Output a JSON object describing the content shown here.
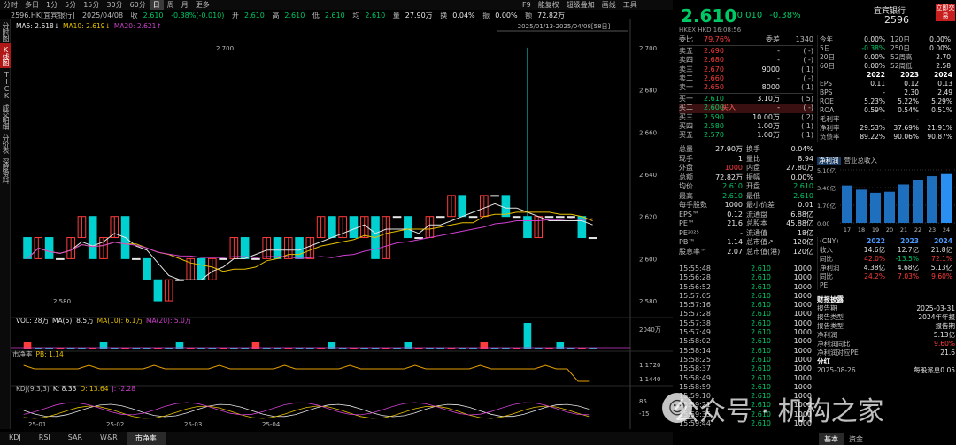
{
  "topbar": {
    "tabs": [
      "分时",
      "多日",
      "1分",
      "5分",
      "15分",
      "30分",
      "60分",
      "日",
      "周",
      "月",
      "更多"
    ],
    "active": "日",
    "right_items": [
      "F9",
      "能复权",
      "超级叠加",
      "画线",
      "工具"
    ]
  },
  "infobar": {
    "symbol": "2596.HK[宜宾银行]",
    "date": "2025/04/08",
    "close_label": "收",
    "close": "2.610",
    "change": "-0.38%(-0.010)",
    "open_label": "开",
    "open": "2.610",
    "high_label": "高",
    "high": "2.610",
    "low_label": "低",
    "low": "2.610",
    "avg_label": "均",
    "avg": "2.610",
    "vol_label": "量",
    "vol": "27.90万",
    "turn_label": "换",
    "turn": "0.04%",
    "amp_label": "振",
    "amp": "0.00%",
    "amt_label": "额",
    "amt": "72.82万"
  },
  "leftnav": [
    "分时图",
    "K线图",
    "TICK",
    "成交明细",
    "分价表",
    "深度资料"
  ],
  "leftnav_active": "K线图",
  "ma_legend": {
    "ma5": "MA5: 2.618↓",
    "ma10": "MA10: 2.619↓",
    "ma20": "MA20: 2.621↑"
  },
  "range_label": "2025/01/13-2025/04/08[58日]",
  "price_axis": [
    "2.700",
    "2.680",
    "2.660",
    "2.640",
    "2.620",
    "2.600",
    "2.580"
  ],
  "high_marker": "2.700",
  "low_marker": "2.580",
  "vol_legend": {
    "vol": "VOL: 28万",
    "ma5": "MA(5): 8.5万",
    "ma10": "MA(10): 6.1万",
    "ma20": "MA(20): 5.0万"
  },
  "vol_axis": "2040万",
  "pb_legend": {
    "name": "市净率",
    "value": "PB: 1.14"
  },
  "pb_axis": [
    "1.1720",
    "1.1440"
  ],
  "kdj_legend": {
    "name": "KDJ(9,3,3)",
    "k": "K: 8.33",
    "d": "D: 13.64",
    "j": "J: -2.28"
  },
  "kdj_axis": [
    "85",
    "-15"
  ],
  "date_axis": [
    "25-01",
    "25-02",
    "25-03",
    "25-04"
  ],
  "bottom_tabs": [
    "KDJ",
    "RSI",
    "SAR",
    "W&R",
    "市净率"
  ],
  "bottom_active": "市净率",
  "quote": {
    "price": "2.610",
    "change": "-0.010",
    "pct": "-0.38%",
    "name": "宜宾银行",
    "code": "2596",
    "trade_btn": "立即交易",
    "exchange": "HKEX  HKD  16:08:56"
  },
  "orderbook": {
    "ratio_label": "委比",
    "ratio": "79.76%",
    "diff_label": "委差",
    "diff": "1340",
    "asks": [
      {
        "l": "卖五",
        "p": "2.690",
        "v": "-",
        "n": "(      -)"
      },
      {
        "l": "卖四",
        "p": "2.680",
        "v": "-",
        "n": "(      -)"
      },
      {
        "l": "卖三",
        "p": "2.670",
        "v": "9000",
        "n": "(      1)"
      },
      {
        "l": "卖二",
        "p": "2.660",
        "v": "-",
        "n": "(      -)"
      },
      {
        "l": "卖一",
        "p": "2.650",
        "v": "8000",
        "n": "(      1)"
      }
    ],
    "bids": [
      {
        "l": "买一",
        "p": "2.610",
        "v": "3.10万",
        "n": "(      5)"
      },
      {
        "l": "买二",
        "p": "2.600",
        "v": "-",
        "n": "(      -)",
        "tag": "买入"
      },
      {
        "l": "买三",
        "p": "2.590",
        "v": "10.00万",
        "n": "(      2)"
      },
      {
        "l": "买四",
        "p": "2.580",
        "v": "1.00万",
        "n": "(      1)"
      },
      {
        "l": "买五",
        "p": "2.570",
        "v": "1.00万",
        "n": "(      1)"
      }
    ]
  },
  "stats": [
    [
      "总量",
      "27.90万",
      "换手",
      "0.04%"
    ],
    [
      "现手",
      "1",
      "量比",
      "8.94"
    ],
    [
      "外盘",
      "1000",
      "内盘",
      "27.80万"
    ],
    [
      "总额",
      "72.82万",
      "振幅",
      "0.00%"
    ],
    [
      "均价",
      "2.610",
      "开盘",
      "2.610"
    ],
    [
      "最高",
      "2.610",
      "最低",
      "2.610"
    ],
    [
      "每手股数",
      "1000",
      "最小价差",
      "0.01"
    ],
    [
      "EPS™",
      "0.12",
      "流通盘",
      "6.88亿"
    ],
    [
      "PE™",
      "21.6",
      "总股本",
      "45.88亿"
    ],
    [
      "PE²⁰²⁵",
      "-",
      "流通值",
      "18亿"
    ],
    [
      "PB™",
      "1.14",
      "总市值↗",
      "120亿"
    ],
    [
      "股息率™",
      "2.07",
      "总市值(港)",
      "120亿"
    ]
  ],
  "ticks": [
    [
      "15:55:48",
      "2.610",
      "1000"
    ],
    [
      "15:56:28",
      "2.610",
      "1000"
    ],
    [
      "15:56:52",
      "2.610",
      "1000"
    ],
    [
      "15:57:05",
      "2.610",
      "1000"
    ],
    [
      "15:57:16",
      "2.610",
      "1000"
    ],
    [
      "15:57:28",
      "2.610",
      "1000"
    ],
    [
      "15:57:38",
      "2.610",
      "1000"
    ],
    [
      "15:57:49",
      "2.610",
      "1000"
    ],
    [
      "15:58:02",
      "2.610",
      "1000"
    ],
    [
      "15:58:14",
      "2.610",
      "1000"
    ],
    [
      "15:58:25",
      "2.610",
      "1000"
    ],
    [
      "15:58:37",
      "2.610",
      "1000"
    ],
    [
      "15:58:49",
      "2.610",
      "1000"
    ],
    [
      "15:58:59",
      "2.610",
      "1000"
    ],
    [
      "15:59:10",
      "2.610",
      "1000"
    ],
    [
      "15:59:21",
      "2.610",
      "1000"
    ],
    [
      "15:59:35",
      "2.610",
      "1000"
    ],
    [
      "15:59:44",
      "2.610",
      "1000"
    ]
  ],
  "fin_top": [
    [
      "今年",
      "0.00%",
      "120日",
      "0.00%"
    ],
    [
      "5日",
      "-0.38%",
      "250日",
      "0.00%"
    ],
    [
      "20日",
      "0.00%",
      "52周高",
      "2.70"
    ],
    [
      "60日",
      "0.00%",
      "52周低",
      "2.58"
    ]
  ],
  "fin_years": [
    "2022",
    "2023",
    "2024"
  ],
  "fin_rows": [
    [
      "EPS",
      "0.11",
      "0.12",
      "0.13"
    ],
    [
      "BPS",
      "-",
      "2.30",
      "2.49"
    ],
    [
      "ROE",
      "5.23%",
      "5.22%",
      "5.29%"
    ],
    [
      "ROA",
      "0.59%",
      "0.54%",
      "0.51%"
    ],
    [
      "毛利率",
      "-",
      "-",
      "-"
    ],
    [
      "净利率",
      "29.53%",
      "37.69%",
      "21.91%"
    ],
    [
      "负债率",
      "89.22%",
      "90.06%",
      "90.87%"
    ]
  ],
  "bar_title": {
    "tab": "净利润",
    "label": "营业总收入"
  },
  "bar_axis": [
    "5.10亿",
    "3.40亿",
    "1.70亿",
    "0.00"
  ],
  "bar_x": [
    "17",
    "18",
    "19",
    "20",
    "21",
    "22",
    "23",
    "24"
  ],
  "fin_unit": "(CNY)",
  "fin_rows2": [
    [
      "收入",
      "14.6亿",
      "12.7亿",
      "21.8亿"
    ],
    [
      "同比",
      "42.0%",
      "-13.5%",
      "72.1%"
    ],
    [
      "净利润",
      "4.38亿",
      "4.68亿",
      "5.13亿"
    ],
    [
      "同比",
      "24.2%",
      "7.03%",
      "9.60%"
    ],
    [
      "PE",
      "",
      "",
      ""
    ]
  ],
  "disclosure": {
    "title": "财报披露",
    "rows": [
      [
        "报告期",
        "2025-03-31"
      ],
      [
        "报告类型",
        "2024年年报"
      ],
      [
        "报告类型",
        "报告期"
      ],
      [
        "净利润",
        "5.13亿"
      ],
      [
        "净利润同比",
        "9.60%"
      ],
      [
        "净利润对应PE",
        "21.6"
      ]
    ],
    "div_title": "分红",
    "div_row": [
      "2025-08-26",
      "每股派息0.05"
    ]
  },
  "right_bottom_tabs": [
    "基本",
    "资金"
  ],
  "watermark": "公众号 · 机构之家",
  "chart_data": {
    "type": "candlestick",
    "x_range": [
      "2025-01-13",
      "2025-04-08"
    ],
    "ylim": [
      2.575,
      2.705
    ],
    "candles": [
      [
        2.61,
        2.6,
        2.61,
        2.6
      ],
      [
        2.6,
        2.61,
        2.61,
        2.6
      ],
      [
        2.61,
        2.6,
        2.61,
        2.6
      ],
      [
        2.6,
        2.6,
        2.6,
        2.6
      ],
      [
        2.6,
        2.61,
        2.61,
        2.6
      ],
      [
        2.61,
        2.62,
        2.62,
        2.61
      ],
      [
        2.62,
        2.6,
        2.62,
        2.6
      ],
      [
        2.6,
        2.61,
        2.61,
        2.6
      ],
      [
        2.61,
        2.62,
        2.62,
        2.61
      ],
      [
        2.62,
        2.6,
        2.62,
        2.6
      ],
      [
        2.6,
        2.6,
        2.6,
        2.6
      ],
      [
        2.6,
        2.59,
        2.6,
        2.59
      ],
      [
        2.59,
        2.58,
        2.59,
        2.58
      ],
      [
        2.58,
        2.59,
        2.59,
        2.58
      ],
      [
        2.59,
        2.59,
        2.59,
        2.59
      ],
      [
        2.59,
        2.6,
        2.6,
        2.59
      ],
      [
        2.6,
        2.59,
        2.6,
        2.59
      ],
      [
        2.59,
        2.6,
        2.6,
        2.59
      ],
      [
        2.6,
        2.6,
        2.6,
        2.6
      ],
      [
        2.6,
        2.61,
        2.61,
        2.6
      ],
      [
        2.61,
        2.6,
        2.61,
        2.6
      ],
      [
        2.6,
        2.6,
        2.6,
        2.6
      ],
      [
        2.6,
        2.61,
        2.61,
        2.6
      ],
      [
        2.61,
        2.6,
        2.61,
        2.6
      ],
      [
        2.6,
        2.61,
        2.61,
        2.6
      ],
      [
        2.61,
        2.6,
        2.61,
        2.6
      ],
      [
        2.6,
        2.61,
        2.61,
        2.6
      ],
      [
        2.61,
        2.62,
        2.62,
        2.61
      ],
      [
        2.62,
        2.61,
        2.62,
        2.61
      ],
      [
        2.61,
        2.62,
        2.62,
        2.61
      ],
      [
        2.62,
        2.61,
        2.62,
        2.61
      ],
      [
        2.61,
        2.62,
        2.62,
        2.61
      ],
      [
        2.62,
        2.6,
        2.62,
        2.6
      ],
      [
        2.6,
        2.62,
        2.62,
        2.6
      ],
      [
        2.62,
        2.62,
        2.62,
        2.62
      ],
      [
        2.62,
        2.61,
        2.62,
        2.61
      ],
      [
        2.61,
        2.61,
        2.61,
        2.61
      ],
      [
        2.61,
        2.62,
        2.62,
        2.61
      ],
      [
        2.62,
        2.62,
        2.62,
        2.62
      ],
      [
        2.62,
        2.63,
        2.63,
        2.62
      ],
      [
        2.63,
        2.62,
        2.63,
        2.62
      ],
      [
        2.62,
        2.62,
        2.62,
        2.62
      ],
      [
        2.62,
        2.63,
        2.63,
        2.62
      ],
      [
        2.63,
        2.63,
        2.63,
        2.63
      ],
      [
        2.63,
        2.62,
        2.63,
        2.62
      ],
      [
        2.62,
        2.62,
        2.62,
        2.62
      ],
      [
        2.62,
        2.61,
        2.7,
        2.61
      ],
      [
        2.61,
        2.62,
        2.62,
        2.61
      ],
      [
        2.62,
        2.62,
        2.62,
        2.62
      ],
      [
        2.62,
        2.62,
        2.62,
        2.62
      ],
      [
        2.62,
        2.62,
        2.62,
        2.62
      ],
      [
        2.62,
        2.61,
        2.62,
        2.61
      ],
      [
        2.61,
        2.61,
        2.61,
        2.61
      ]
    ],
    "bar_values": [
      3.6,
      3.2,
      2.9,
      3.0,
      3.7,
      4.1,
      4.5,
      4.7
    ]
  }
}
